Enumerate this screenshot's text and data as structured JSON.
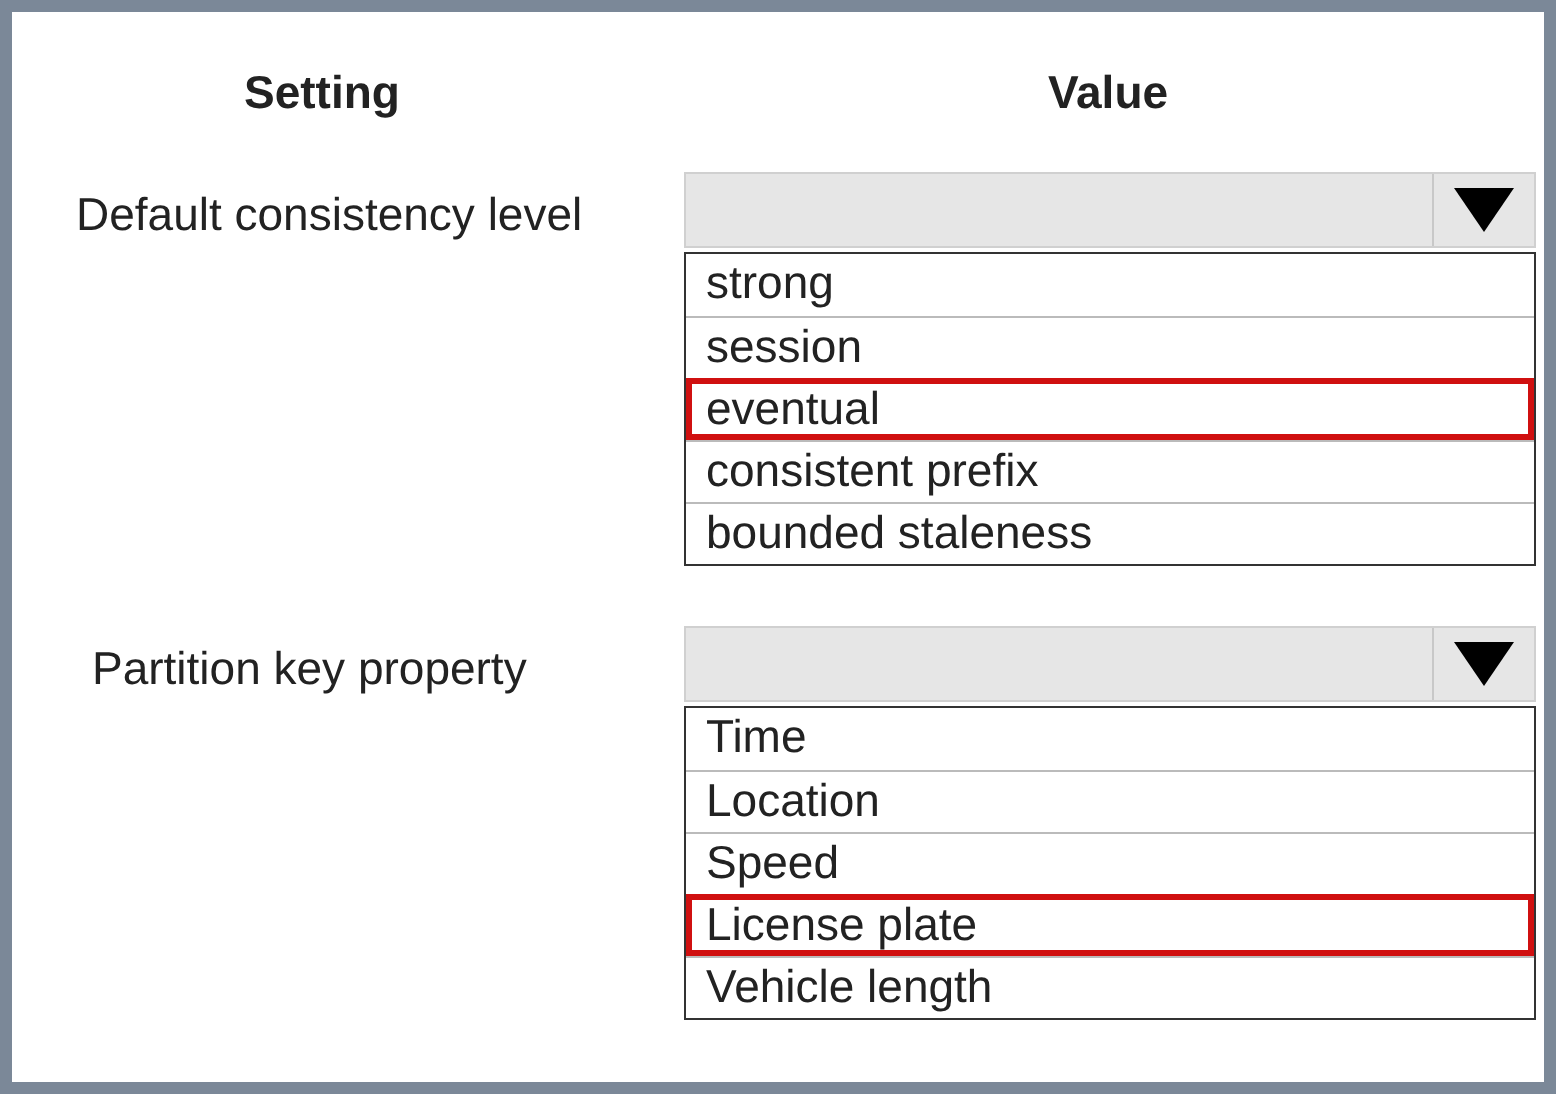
{
  "headers": {
    "setting": "Setting",
    "value": "Value"
  },
  "settings": [
    {
      "label": "Default consistency level",
      "options": [
        {
          "label": "strong",
          "selected": false
        },
        {
          "label": "session",
          "selected": false
        },
        {
          "label": "eventual",
          "selected": true
        },
        {
          "label": "consistent prefix",
          "selected": false
        },
        {
          "label": "bounded staleness",
          "selected": false
        }
      ]
    },
    {
      "label": "Partition key property",
      "options": [
        {
          "label": "Time",
          "selected": false
        },
        {
          "label": "Location",
          "selected": false
        },
        {
          "label": "Speed",
          "selected": false
        },
        {
          "label": "License plate",
          "selected": true
        },
        {
          "label": "Vehicle length",
          "selected": false
        }
      ]
    }
  ]
}
